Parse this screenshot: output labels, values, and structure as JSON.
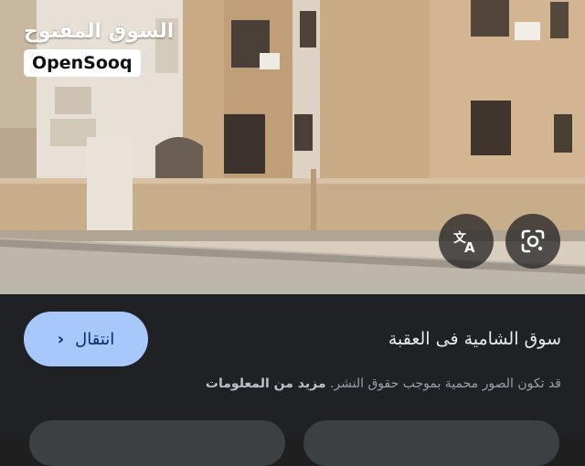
{
  "watermark": {
    "arabic": "السوق المفتوح",
    "latin": "OpenSooq"
  },
  "photo": {
    "description_icon_translate": "translate-icon",
    "description_icon_lens": "lens-icon"
  },
  "result": {
    "title": "سوق الشامية فى العقبة",
    "visit_label": "انتقال",
    "copyright_notice": "قد تكون الصور محمية بموجب حقوق النشر.",
    "more_info": "مزيد من المعلومات"
  },
  "colors": {
    "panel_bg": "#202124",
    "visit_button_bg": "#a8c7fa",
    "title_text": "#e8eaed",
    "notice_text": "#9aa0a6"
  }
}
